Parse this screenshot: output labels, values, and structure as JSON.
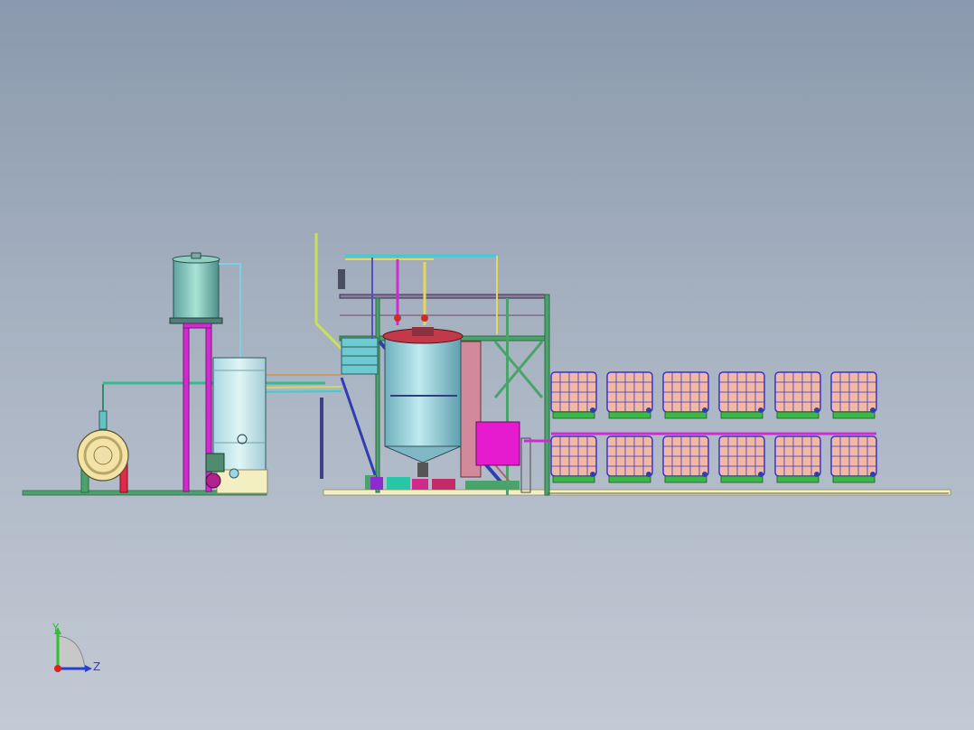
{
  "viewport": {
    "background_top": "#8a99ad",
    "background_bottom": "#c3cad5"
  },
  "model": {
    "ibc_tote_count": 12,
    "ibc_rows": 2,
    "ibc_columns": 6,
    "colors": {
      "frame_green": "#4aa36b",
      "pipe_magenta": "#d02bd0",
      "pipe_cyan": "#38d0d8",
      "tank_steel": "#9ed0da",
      "tote_fill": "#f1b9a3",
      "tote_cage": "#3a34c8",
      "pallet_green": "#3cb84a",
      "base_plate": "#f4efc2",
      "control_box": "#e61bd0"
    }
  },
  "triad": {
    "y_label": "Y",
    "z_label": "Z",
    "y_color": "#2fbf2f",
    "z_color": "#2a3ecf",
    "x_color": "#e02020"
  }
}
